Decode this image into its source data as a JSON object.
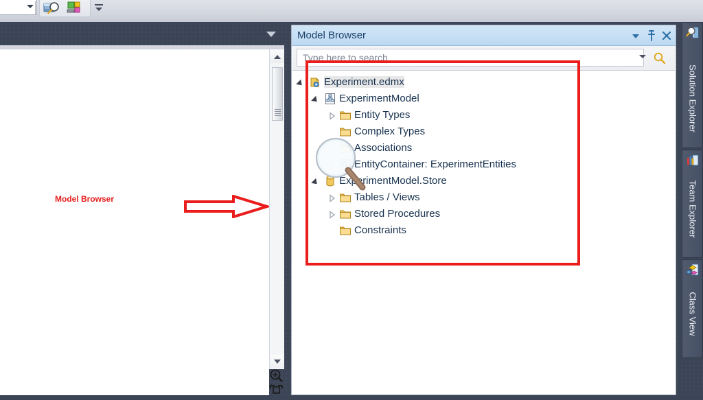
{
  "toolbar": {
    "combo_value": "",
    "buttons": [
      {
        "name": "zoom-tool-icon",
        "label": "Zoom"
      },
      {
        "name": "color-palette-icon",
        "label": "Properties"
      }
    ],
    "overflow_label": "Toolbar Options"
  },
  "designer": {
    "annotation_label": "Model Browser",
    "annotation_color": "#e51c1c",
    "zoom_in_label": "Zoom In",
    "fit_label": "Fit to Window",
    "scroll_up_label": "Scroll Up",
    "scroll_down_label": "Scroll Down",
    "tab_dropdown_label": "Document Window Dropdown"
  },
  "model_browser": {
    "title": "Model Browser",
    "title_buttons": [
      {
        "name": "window-dropdown-icon",
        "label": "Window Options"
      },
      {
        "name": "pin-icon",
        "label": "Auto Hide"
      },
      {
        "name": "close-icon",
        "label": "Close"
      }
    ],
    "search": {
      "placeholder": "Type here to search",
      "value": "",
      "dropdown_label": "Search Options",
      "search_icon_label": "Search"
    },
    "tree": [
      {
        "label": "Experiment.edmx",
        "icon": "edmx-file-icon",
        "depth": 0,
        "twisty": "open",
        "selected": true
      },
      {
        "label": "ExperimentModel",
        "icon": "conceptual-model-icon",
        "depth": 1,
        "twisty": "open",
        "selected": false
      },
      {
        "label": "Entity Types",
        "icon": "folder-icon",
        "depth": 2,
        "twisty": "closed",
        "selected": false
      },
      {
        "label": "Complex Types",
        "icon": "folder-icon",
        "depth": 2,
        "twisty": "none",
        "selected": false
      },
      {
        "label": "Associations",
        "icon": "folder-icon",
        "depth": 2,
        "twisty": "none",
        "selected": false
      },
      {
        "label": "EntityContainer: ExperimentEntities",
        "icon": "entity-container-icon",
        "depth": 2,
        "twisty": "closed",
        "selected": false
      },
      {
        "label": "ExperimentModel.Store",
        "icon": "database-icon",
        "depth": 1,
        "twisty": "open",
        "selected": false
      },
      {
        "label": "Tables / Views",
        "icon": "folder-icon",
        "depth": 2,
        "twisty": "closed",
        "selected": false
      },
      {
        "label": "Stored Procedures",
        "icon": "folder-icon",
        "depth": 2,
        "twisty": "closed",
        "selected": false
      },
      {
        "label": "Constraints",
        "icon": "folder-icon",
        "depth": 2,
        "twisty": "none",
        "selected": false
      }
    ],
    "highlight_color": "#ea1c1c"
  },
  "right_dock": {
    "tabs": [
      {
        "label": "Solution Explorer",
        "icon": "solution-explorer-icon"
      },
      {
        "label": "Team Explorer",
        "icon": "team-explorer-icon"
      },
      {
        "label": "Class View",
        "icon": "class-view-icon"
      }
    ]
  }
}
